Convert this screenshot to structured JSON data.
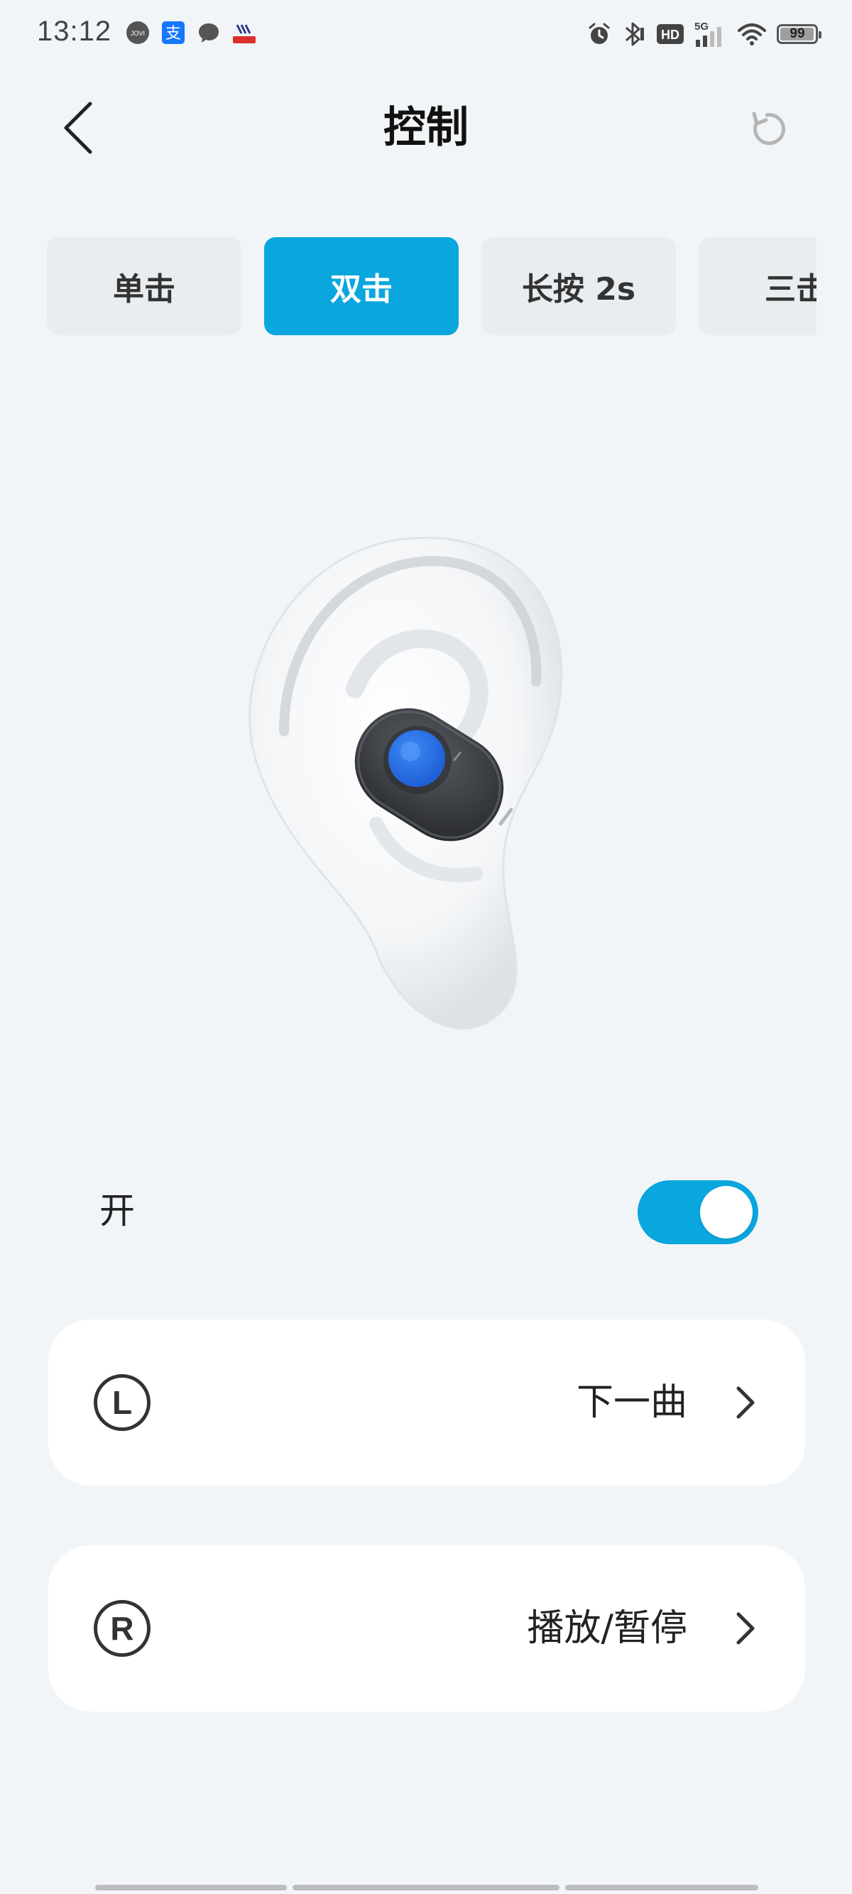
{
  "status_bar": {
    "time": "13:12",
    "notification_icons": [
      "jovi-icon",
      "alipay-icon",
      "message-icon",
      "bank-app-icon"
    ],
    "right_icons": [
      "alarm-icon",
      "bluetooth-icon",
      "hd-icon",
      "signal-5g-icon",
      "wifi-icon"
    ],
    "network": "5G",
    "hd_label": "HD",
    "battery_level": "99"
  },
  "header": {
    "title": "控制"
  },
  "tabs": [
    {
      "label": "单击",
      "active": false
    },
    {
      "label": "双击",
      "active": true
    },
    {
      "label": "长按 2s",
      "active": false
    },
    {
      "label": "三击",
      "active": false
    }
  ],
  "toggle": {
    "label": "开",
    "on": true
  },
  "settings": {
    "left": {
      "side": "L",
      "value": "下一曲"
    },
    "right": {
      "side": "R",
      "value": "播放/暂停"
    }
  },
  "colors": {
    "accent": "#0aa6de",
    "background": "#f2f5f8",
    "card": "#ffffff",
    "tab_inactive": "#e9edf0"
  }
}
